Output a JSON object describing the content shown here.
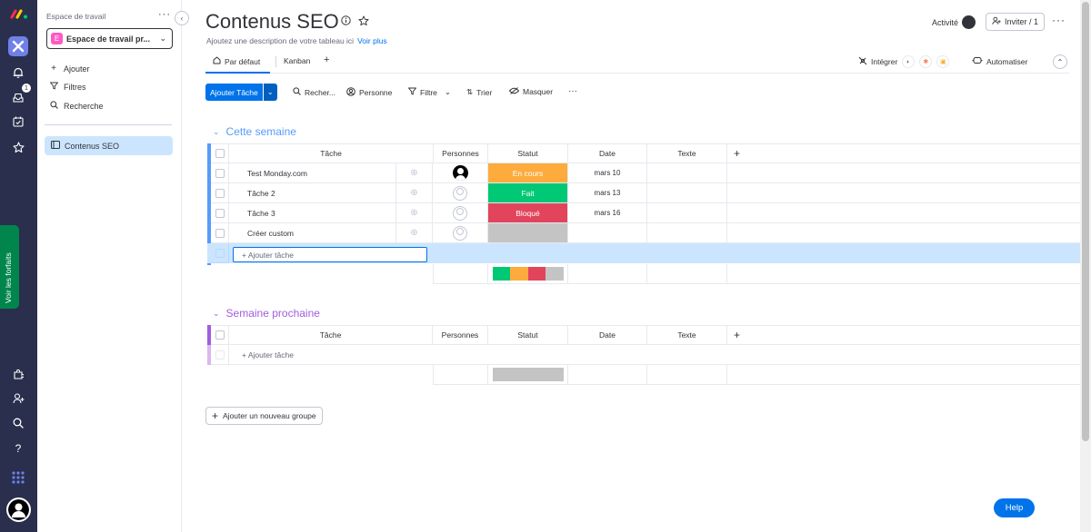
{
  "rail": {
    "notifications_badge": "1",
    "plans_label": "Voir les forfaits"
  },
  "sidebar": {
    "workspace_label": "Espace de travail",
    "workspace_name": "Espace de travail pr...",
    "workspace_initial": "E",
    "menu": [
      {
        "label": "Ajouter",
        "icon": "plus-icon"
      },
      {
        "label": "Filtres",
        "icon": "filter-icon"
      },
      {
        "label": "Recherche",
        "icon": "search-icon"
      }
    ],
    "boards": [
      {
        "label": "Contenus SEO",
        "icon": "board-icon"
      }
    ]
  },
  "header": {
    "title": "Contenus SEO",
    "description": "Ajoutez une description de votre tableau ici",
    "see_more": "Voir plus",
    "activity": "Activité",
    "invite": "Inviter / 1"
  },
  "tabs": [
    {
      "label": "Par défaut",
      "icon": "home-icon"
    },
    {
      "label": "Kanban"
    },
    {
      "label": "+"
    }
  ],
  "integrate": {
    "label": "Intégrer"
  },
  "automate": {
    "label": "Automatiser"
  },
  "toolbar": {
    "add_task": "Ajouter Tâche",
    "search": "Recher...",
    "person": "Personne",
    "filter": "Filtre",
    "sort": "Trier",
    "hide": "Masquer",
    "more": "···"
  },
  "columns": [
    "Tâche",
    "Personnes",
    "Statut",
    "Date",
    "Texte",
    "+"
  ],
  "colors": {
    "group1": "#579bfc",
    "group2": "#a25ddc",
    "status_en_cours": "#fdab3d",
    "status_fait": "#00c875",
    "status_bloque": "#e2445c",
    "status_empty": "#c4c4c4",
    "accent": "#0073ea"
  },
  "groups": [
    {
      "title": "Cette semaine",
      "rows": [
        {
          "task": "Test Monday.com",
          "person": "filled",
          "status": "En cours",
          "status_key": "en_cours",
          "date": "mars 10",
          "text": ""
        },
        {
          "task": "Tâche 2",
          "person": "empty",
          "status": "Fait",
          "status_key": "fait",
          "date": "mars 13",
          "text": ""
        },
        {
          "task": "Tâche 3",
          "person": "empty",
          "status": "Bloqué",
          "status_key": "bloque",
          "date": "mars 16",
          "text": ""
        },
        {
          "task": "Créer custom",
          "person": "empty",
          "status": "",
          "status_key": "empty",
          "date": "",
          "text": ""
        }
      ],
      "add_task": "+ Ajouter tâche"
    },
    {
      "title": "Semaine prochaine",
      "rows": [],
      "add_task": "+ Ajouter tâche"
    }
  ],
  "add_group": "Ajouter un nouveau groupe",
  "help": "Help"
}
